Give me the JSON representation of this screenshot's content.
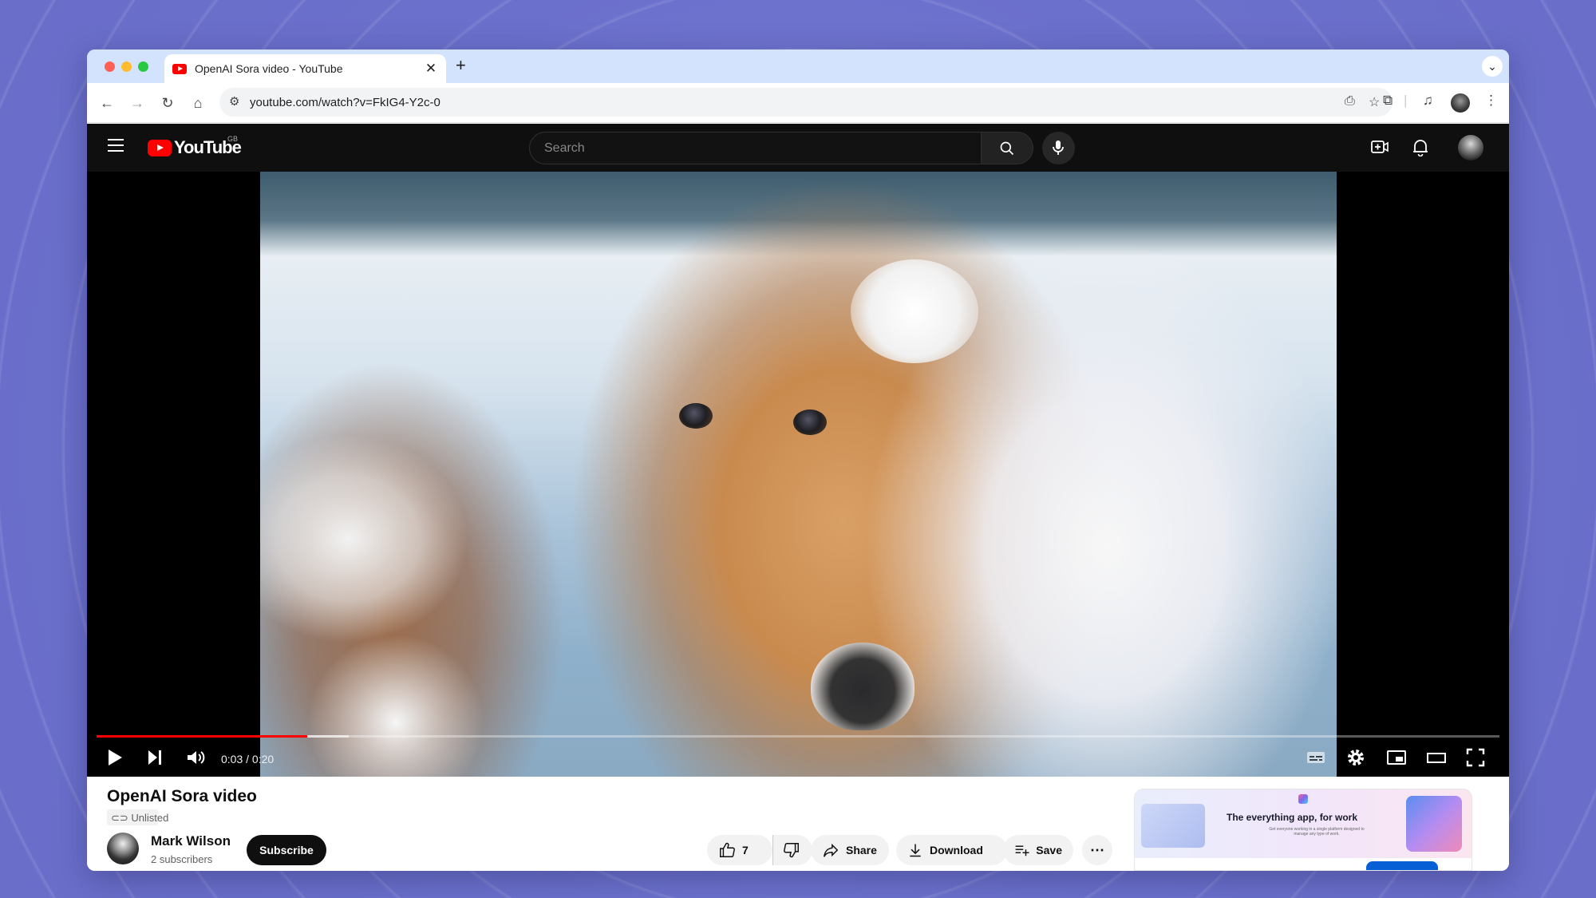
{
  "browser": {
    "tab_title": "OpenAI Sora video - YouTube",
    "tab_close": "✕",
    "new_tab": "+",
    "url": "youtube.com/watch?v=FkIG4-Y2c-0"
  },
  "youtube": {
    "logo_text": "YouTube",
    "region": "GB",
    "search_placeholder": "Search"
  },
  "player": {
    "time": "0:03 / 0:20",
    "played_fraction": 0.15,
    "buffered_fraction": 0.18
  },
  "video": {
    "title": "OpenAI Sora video",
    "visibility": "Unlisted",
    "channel_name": "Mark Wilson",
    "subscribers": "2 subscribers",
    "subscribe_label": "Subscribe",
    "likes": "7",
    "share_label": "Share",
    "download_label": "Download",
    "save_label": "Save",
    "more_label": "⋯"
  },
  "ad": {
    "headline": "The everything app, for work",
    "subline": "Get everyone working in a single platform designed to manage any type of work."
  },
  "colors": {
    "brand_red": "#ff0000",
    "header_bg": "#0f0f0f",
    "tab_bar_bg": "#d3e3fd"
  }
}
